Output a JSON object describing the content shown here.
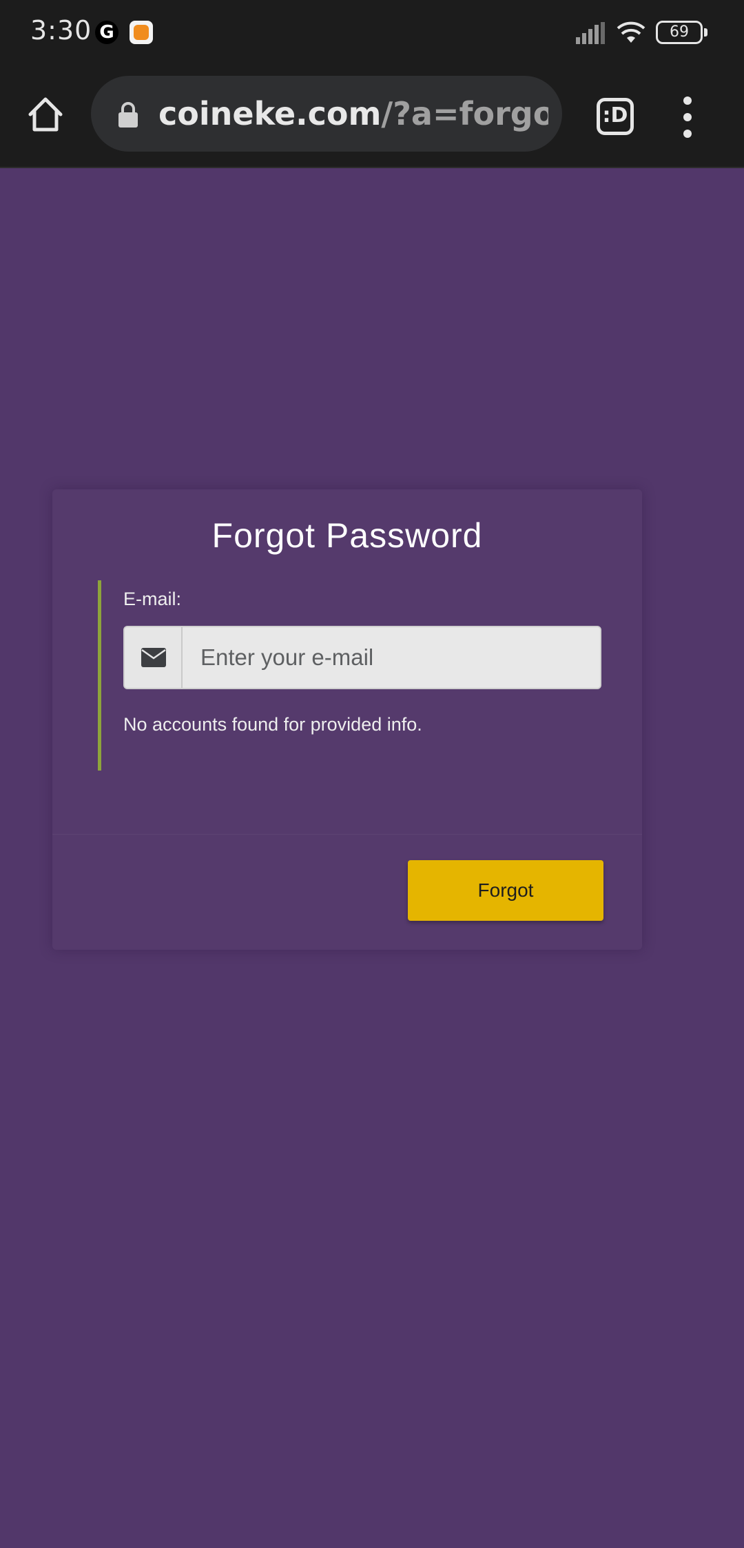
{
  "status_bar": {
    "time": "3:30",
    "g_icon_letter": "G",
    "battery_level": "69"
  },
  "browser": {
    "url_domain": "coineke.com",
    "url_path": "/?a=forgot_p",
    "tab_switcher_label": ":D"
  },
  "page": {
    "title": "Forgot Password",
    "email_label": "E-mail:",
    "email_placeholder": "Enter your e-mail",
    "error_message": "No accounts found for provided info.",
    "submit_label": "Forgot"
  },
  "colors": {
    "background": "#52376a",
    "card": "#553a6c",
    "accent_border": "#8ea43b",
    "button": "#e5b500"
  }
}
